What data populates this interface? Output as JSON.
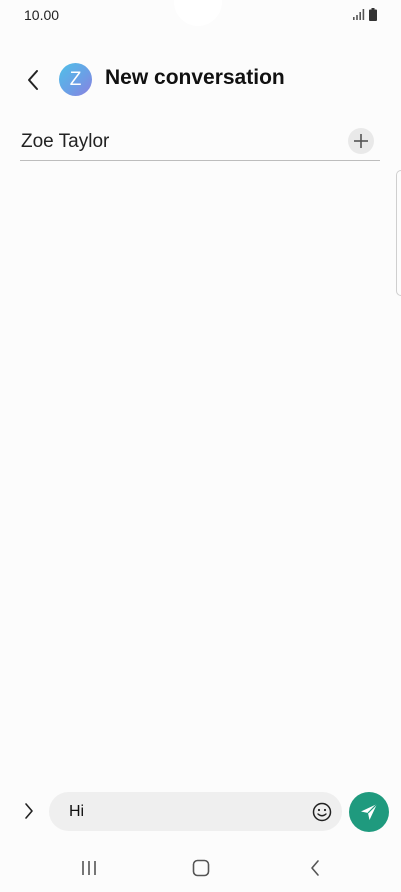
{
  "status_bar": {
    "time": "10.00",
    "icons": [
      "signal-icon",
      "battery-icon"
    ]
  },
  "header": {
    "back_icon": "chevron-left-icon",
    "avatar_initial": "Z",
    "title": "New conversation"
  },
  "recipients": {
    "name": "Zoe Taylor",
    "add_icon": "plus-icon"
  },
  "composer": {
    "expand_icon": "chevron-right-icon",
    "message_value": "Hi",
    "emoji_icon": "smiley-icon",
    "send_icon": "paper-plane-icon"
  },
  "nav_bar": {
    "icons": [
      "recent-apps-icon",
      "home-icon",
      "back-icon"
    ]
  },
  "colors": {
    "background": "#fcfcfc",
    "send_button": "#1f9a7e",
    "input_background": "#efefef"
  }
}
